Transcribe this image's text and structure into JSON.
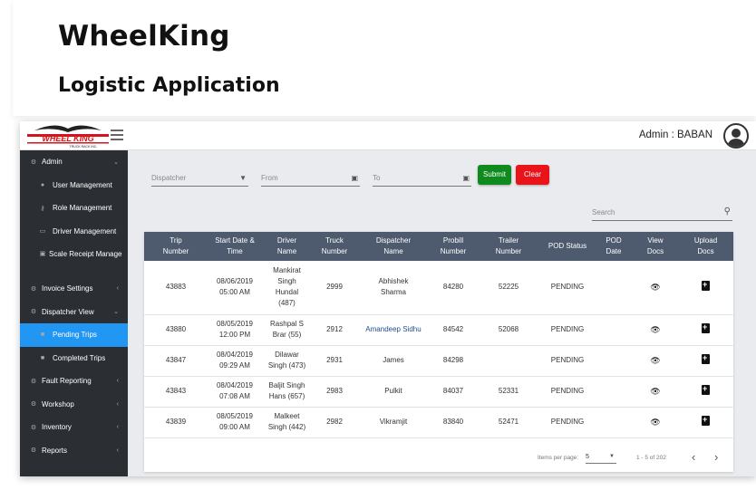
{
  "hero": {
    "title": "WheelKing",
    "subtitle": "Logistic Application"
  },
  "topbar": {
    "logo_text": "WHEEL KING",
    "logo_tagline": "TRUCK RACK INC.",
    "admin_label": "Admin : BABAN"
  },
  "sidebar": {
    "items": [
      {
        "label": "Admin",
        "icon": "gears-icon",
        "chevron": "⌄"
      },
      {
        "label": "User Management",
        "icon": "user-icon"
      },
      {
        "label": "Role Management",
        "icon": "key-icon"
      },
      {
        "label": "Driver Management",
        "icon": "id-card-icon"
      },
      {
        "label": "Scale Receipt Manage",
        "icon": "receipt-icon"
      },
      {
        "label": "Invoice Settings",
        "icon": "gears-icon",
        "chevron": "‹"
      },
      {
        "label": "Dispatcher View",
        "icon": "gears-icon",
        "chevron": "⌄"
      },
      {
        "label": "Pending Trips",
        "icon": "truck-icon"
      },
      {
        "label": "Completed Trips",
        "icon": "truck-icon"
      },
      {
        "label": "Fault Reporting",
        "icon": "gears-icon",
        "chevron": "‹"
      },
      {
        "label": "Workshop",
        "icon": "gears-icon",
        "chevron": "‹"
      },
      {
        "label": "Inventory",
        "icon": "gears-icon",
        "chevron": "‹"
      },
      {
        "label": "Reports",
        "icon": "gears-icon",
        "chevron": "‹"
      }
    ]
  },
  "filters": {
    "dispatcher_placeholder": "Dispatcher",
    "from_placeholder": "From",
    "to_placeholder": "To",
    "submit_label": "Submit",
    "clear_label": "Clear",
    "search_placeholder": "Search"
  },
  "table": {
    "headers": [
      [
        "Trip",
        "Number"
      ],
      [
        "Start Date &",
        "Time"
      ],
      [
        "Driver",
        "Name"
      ],
      [
        "Truck",
        "Number"
      ],
      [
        "Dispatcher",
        "Name"
      ],
      [
        "Probill",
        "Number"
      ],
      [
        "Trailer",
        "Number"
      ],
      [
        "POD Status",
        ""
      ],
      [
        "POD",
        "Date"
      ],
      [
        "View",
        "Docs"
      ],
      [
        "Upload",
        "Docs"
      ]
    ],
    "rows": [
      {
        "trip": "43883",
        "date": "08/06/2019",
        "time": "05:00 AM",
        "driver": [
          "Mankirat",
          "Singh",
          "Hundal",
          "(487)"
        ],
        "truck": "2999",
        "dispatcher": [
          "Abhishek",
          "Sharma"
        ],
        "probill": "84280",
        "trailer": "52225",
        "pod_status": "PENDING",
        "pod_date": "",
        "dispatcher_link": false
      },
      {
        "trip": "43880",
        "date": "08/05/2019",
        "time": "12:00 PM",
        "driver": [
          "Rashpal S",
          "Brar (55)"
        ],
        "truck": "2912",
        "dispatcher": [
          "Amandeep Sidhu"
        ],
        "probill": "84542",
        "trailer": "52068",
        "pod_status": "PENDING",
        "pod_date": "",
        "dispatcher_link": true
      },
      {
        "trip": "43847",
        "date": "08/04/2019",
        "time": "09:29 AM",
        "driver": [
          "Dilawar",
          "Singh (473)"
        ],
        "truck": "2931",
        "dispatcher": [
          "James"
        ],
        "probill": "84298",
        "trailer": "",
        "pod_status": "PENDING",
        "pod_date": "",
        "dispatcher_link": false
      },
      {
        "trip": "43843",
        "date": "08/04/2019",
        "time": "07:08 AM",
        "driver": [
          "Baljit Singh",
          "Hans (657)"
        ],
        "truck": "2983",
        "dispatcher": [
          "Pulkit"
        ],
        "probill": "84037",
        "trailer": "52331",
        "pod_status": "PENDING",
        "pod_date": "",
        "dispatcher_link": false
      },
      {
        "trip": "43839",
        "date": "08/05/2019",
        "time": "09:00 AM",
        "driver": [
          "Malkeet",
          "Singh (442)"
        ],
        "truck": "2982",
        "dispatcher": [
          "Vikramjit"
        ],
        "probill": "83840",
        "trailer": "52471",
        "pod_status": "PENDING",
        "pod_date": "",
        "dispatcher_link": false
      }
    ]
  },
  "pager": {
    "items_per_page_label": "Items per page:",
    "items_per_page_value": "5",
    "range_label": "1 - 5 of 202",
    "prev": "‹",
    "next": "›"
  },
  "colors": {
    "sidebar_bg": "#2b2f33",
    "active_item": "#2196f3",
    "table_header": "#4e5b6e",
    "submit": "#0e8a1e",
    "clear": "#e8141a",
    "logo_red": "#d4141a"
  }
}
